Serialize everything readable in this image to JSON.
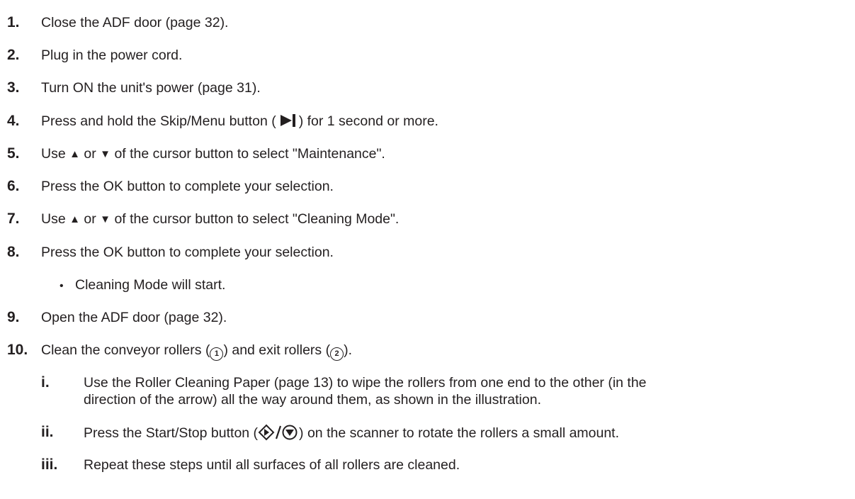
{
  "steps": [
    {
      "num": "1.",
      "text": "Close the ADF door (page 32)."
    },
    {
      "num": "2.",
      "text": "Plug in the power cord."
    },
    {
      "num": "3.",
      "text": "Turn ON the unit's power (page 31)."
    },
    {
      "num": "4.",
      "pre": "Press and hold the Skip/Menu button (",
      "post": ") for 1 second or more."
    },
    {
      "num": "5.",
      "a": "Use",
      "b": "or",
      "c": "of the cursor button to select \"Maintenance\"."
    },
    {
      "num": "6.",
      "text": "Press the OK button to complete your selection."
    },
    {
      "num": "7.",
      "a": "Use",
      "b": "or",
      "c": "of the cursor button to select \"Cleaning Mode\"."
    },
    {
      "num": "8.",
      "text": "Press the OK button to complete your selection."
    },
    {
      "num": "9.",
      "text": "Open the ADF door (page 32)."
    },
    {
      "num": "10.",
      "a": "Clean the conveyor rollers (",
      "b": ") and exit rollers (",
      "c": ")."
    }
  ],
  "step8_note": "Cleaning Mode will start.",
  "bullet_glyph": "•",
  "up_glyph": "▲",
  "down_glyph": "▼",
  "circled": [
    "1",
    "2"
  ],
  "substeps": [
    {
      "num": "i.",
      "lines": [
        "Use the Roller Cleaning Paper (page 13) to wipe the rollers from one end to the other (in the",
        "direction of the arrow) all the way around them, as shown in the illustration."
      ]
    },
    {
      "num": "ii.",
      "pre": "Press the Start/Stop button (",
      "post": ") on the scanner to rotate the rollers a small amount."
    },
    {
      "num": "iii.",
      "lines": [
        "Repeat these steps until all surfaces of all rollers are cleaned."
      ]
    }
  ],
  "icons": {
    "skip": "skip-menu-icon",
    "start_stop": "start-stop-icon",
    "cursor_up": "cursor-up-icon",
    "cursor_down": "cursor-down-icon"
  }
}
